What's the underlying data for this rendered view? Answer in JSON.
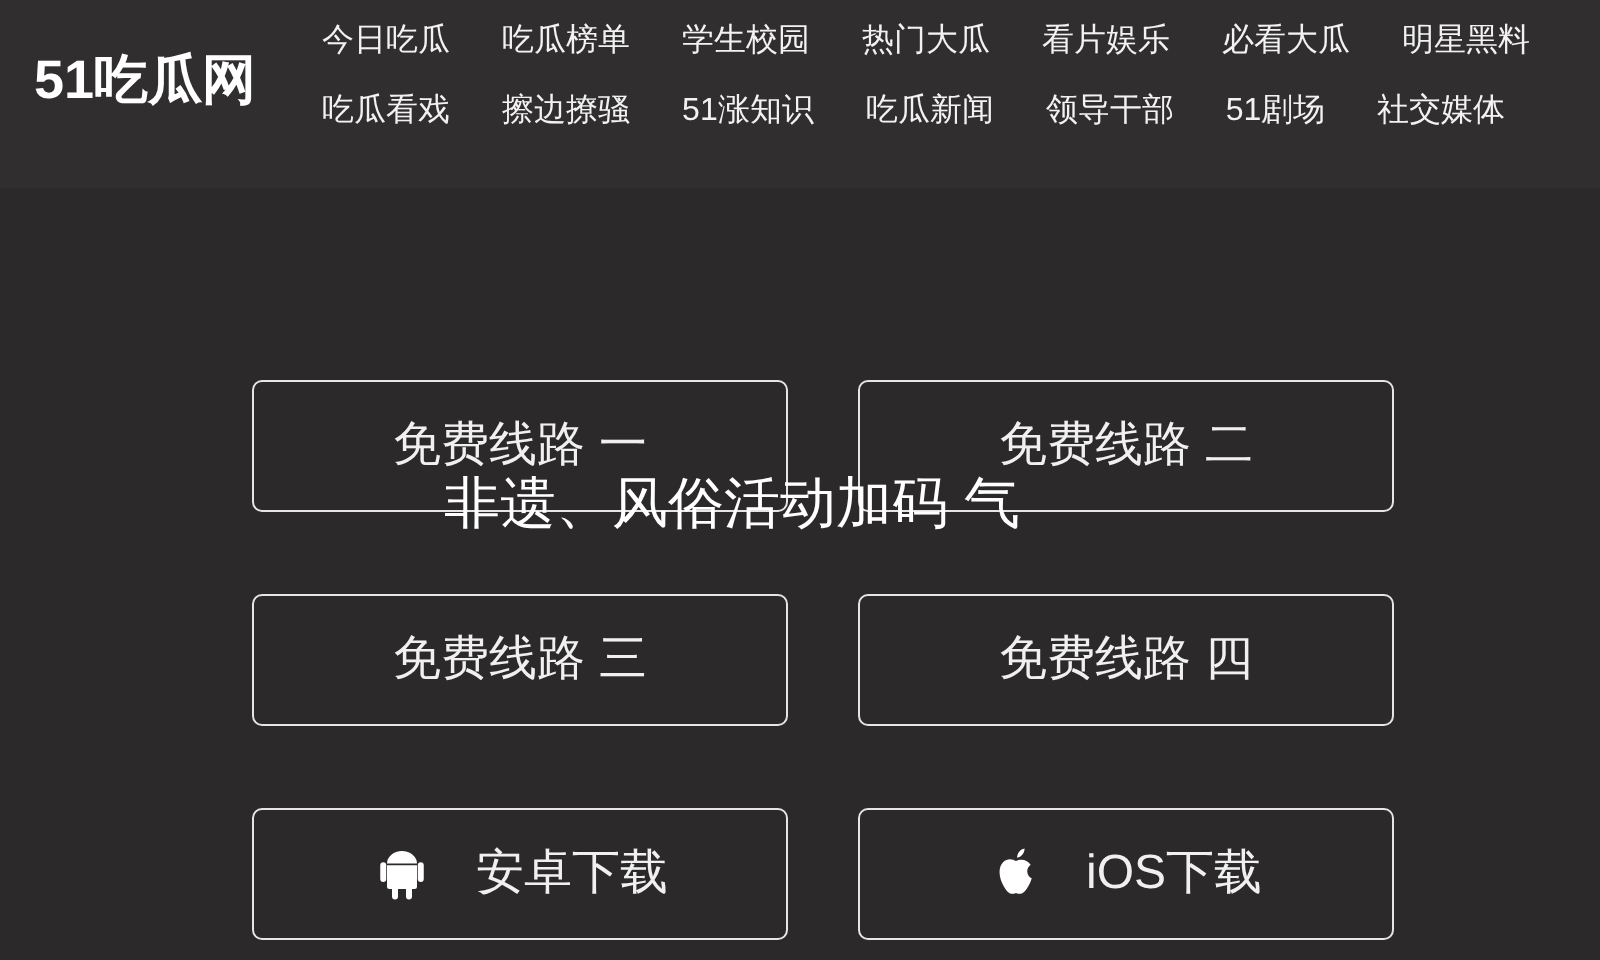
{
  "header": {
    "logo": "51吃瓜网",
    "nav_rows": [
      [
        "今日吃瓜",
        "吃瓜榜单",
        "学生校园",
        "热门大瓜",
        "看片娱乐",
        "必看大瓜",
        "明星黑料"
      ],
      [
        "吃瓜看戏",
        "擦边撩骚",
        "51涨知识",
        "吃瓜新闻",
        "领导干部",
        "51剧场",
        "社交媒体"
      ]
    ]
  },
  "routes": [
    "免费线路 一",
    "免费线路 二",
    "免费线路 三",
    "免费线路 四"
  ],
  "overlay_text": "非遗、风俗活动加码 气",
  "downloads": [
    {
      "kind": "android",
      "label": "安卓下载"
    },
    {
      "kind": "ios",
      "label": "iOS下载"
    }
  ]
}
